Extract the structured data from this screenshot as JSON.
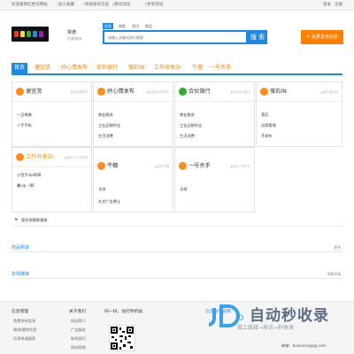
{
  "topbar": {
    "welcome": "欢迎来到红色页网站",
    "links": [
      "加入收藏",
      "快速发布信息",
      "移动浏览",
      "手机浏览"
    ],
    "login": "登录",
    "register": "注册"
  },
  "header": {
    "city": "常德",
    "city_switch": "切换城市",
    "search_tabs": [
      "信息",
      "商家",
      "资讯",
      "商品"
    ],
    "search_placeholder": "请输入关键词进行搜索",
    "search_button": "搜 索",
    "post_button": "免费发布信息"
  },
  "nav": {
    "items": [
      "首页",
      "便宜货",
      "好心情发布",
      "合伙银行",
      "萤石IN",
      "工作共享站",
      "牛棚",
      "一号杀手"
    ]
  },
  "cards": [
    {
      "title": "便宜货",
      "more": "▲发布便宜货",
      "icon_color": "#ff8c1a",
      "items": [
        "一日电脑",
        "二手手机"
      ]
    },
    {
      "title": "好心情发布",
      "more": "▲发布好心情发布",
      "icon_color": "#ff8c1a",
      "items": [
        "商业服务",
        "工业品制作业",
        "生活消费"
      ]
    },
    {
      "title": "合伙银行",
      "more": "▲发布合伙银行",
      "icon_color": "#33aa33",
      "items": [
        "商业服务",
        "工业品制作业",
        "生活消费"
      ]
    },
    {
      "title": "萤石IN",
      "more": "▲发布萤石IN",
      "icon_color": "#ff8c1a",
      "items": [
        "萤石",
        "远程管理",
        "不发布"
      ]
    },
    {
      "title": "工作共享站",
      "more": "▲发布工作共享站",
      "icon_color": "#ff8c1a",
      "items": [
        "小型大vip岗哥",
        "暑vip（哥）"
      ]
    },
    {
      "title": "牛棚",
      "more": "▲发布牛棚",
      "icon_color": "#ff8c1a",
      "items": [
        "全部",
        "在艺广告牌士"
      ]
    },
    {
      "title": "一号杀手",
      "more": "▲发布一号杀手",
      "icon_color": "#ff8c1a",
      "items": [
        "全部"
      ]
    }
  ],
  "notice": {
    "text": "暂住场稳稳通道"
  },
  "sections": [
    {
      "title": "商品频道",
      "more": "更多"
    },
    {
      "title": "友情链接",
      "more": "我要申请"
    }
  ],
  "footer": {
    "col1_title": "信息管理",
    "col1_links": [
      "免费发布信息",
      "修改/删除信息",
      "信息快速搜索"
    ],
    "col2_title": "关于我们",
    "col2_links": [
      "网站简介",
      "广告服务",
      "联系我们",
      "网站帮助"
    ],
    "col3_title": "扫一扫，访问手机站",
    "col4_title": "信息发布说明",
    "email": "邮箱：business@qq.com"
  },
  "watermark": {
    "brand": "自动秒收录",
    "sub": "做上链接→来访→秒收录",
    "logo": "JD"
  },
  "colors": {
    "accent": "#1e88e5",
    "orange": "#ff7f00"
  }
}
